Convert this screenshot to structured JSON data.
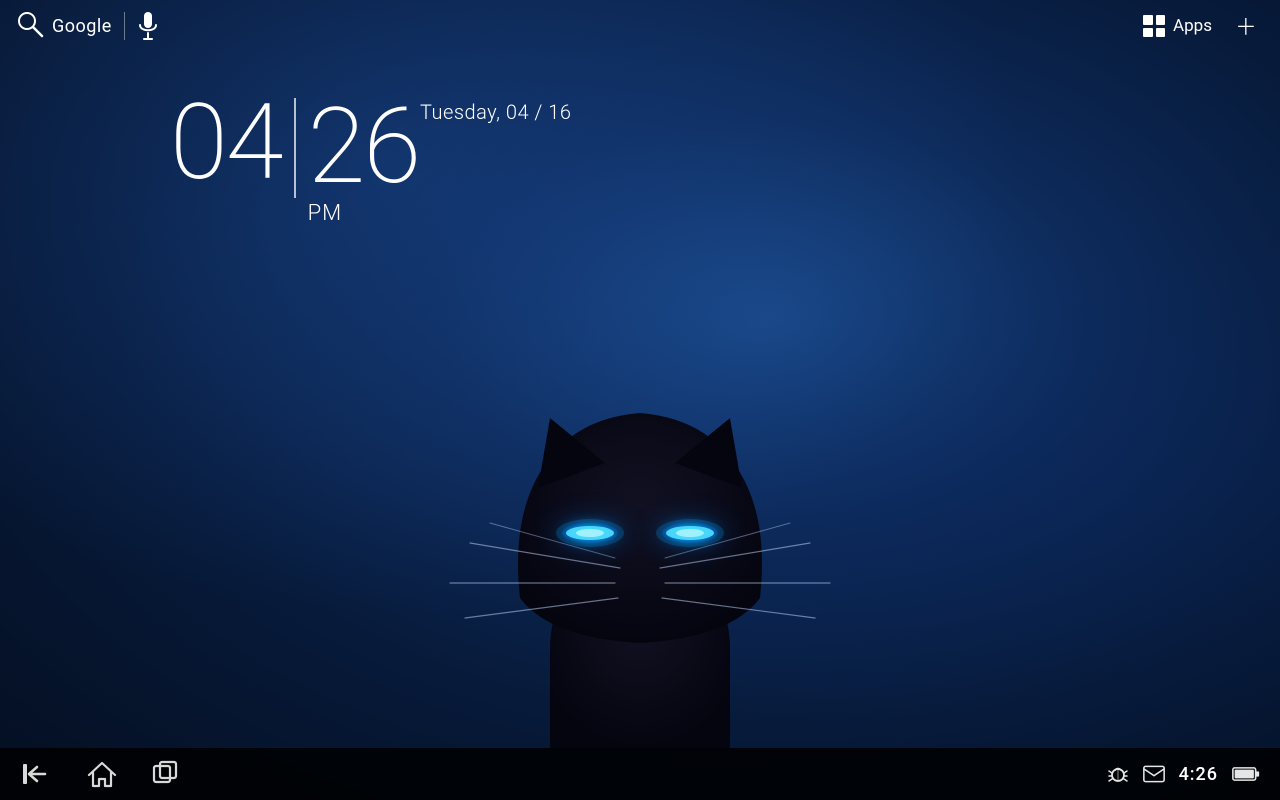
{
  "topbar": {
    "google_label": "Google",
    "apps_label": "Apps",
    "add_label": "+"
  },
  "clock": {
    "hours": "04",
    "minutes": "26",
    "ampm": "PM",
    "date": "Tuesday, 04 / 16"
  },
  "navbar": {
    "status_time": "4:26"
  },
  "colors": {
    "background": "#0a1a3a",
    "accent_blue": "#1a6aff",
    "eye_glow": "#00aaff"
  }
}
